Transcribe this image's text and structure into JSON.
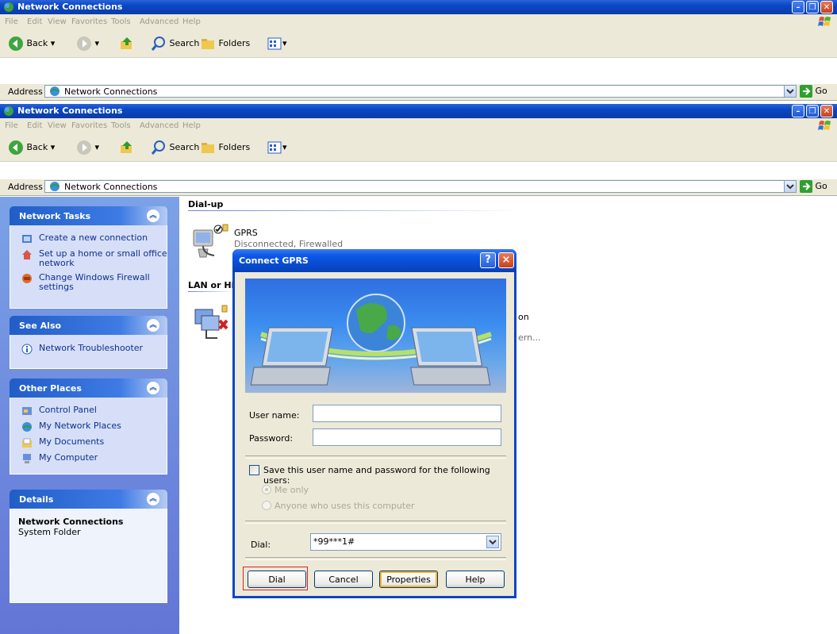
{
  "back_window": {
    "title": "Network Connections",
    "menu": [
      "File",
      "Edit",
      "View",
      "Favorites",
      "Tools",
      "Advanced",
      "Help"
    ],
    "toolbar": {
      "back": "Back",
      "search": "Search",
      "folders": "Folders"
    },
    "address_label": "Address",
    "address_value": "Network Connections",
    "go_label": "Go"
  },
  "window": {
    "title": "Network Connections",
    "menu": [
      "File",
      "Edit",
      "View",
      "Favorites",
      "Tools",
      "Advanced",
      "Help"
    ],
    "toolbar": {
      "back": "Back",
      "search": "Search",
      "folders": "Folders"
    },
    "address_label": "Address",
    "address_value": "Network Connections",
    "go_label": "Go"
  },
  "sidebar": {
    "network_tasks": {
      "title": "Network Tasks",
      "items": [
        "Create a new connection",
        "Set up a home or small office network",
        "Change Windows Firewall settings"
      ]
    },
    "see_also": {
      "title": "See Also",
      "items": [
        "Network Troubleshooter"
      ]
    },
    "other_places": {
      "title": "Other Places",
      "items": [
        "Control Panel",
        "My Network Places",
        "My Documents",
        "My Computer"
      ]
    },
    "details": {
      "title": "Details",
      "name": "Network Connections",
      "type": "System Folder"
    }
  },
  "content": {
    "dialup_header": "Dial-up",
    "gprs_name": "GPRS",
    "gprs_status": "Disconnected, Firewalled",
    "lan_header": "LAN or Hi",
    "lan_text_1": "on",
    "lan_text_2": "ern..."
  },
  "dialog": {
    "title": "Connect GPRS",
    "help_glyph": "?",
    "close_glyph": "×",
    "username_label": "User name:",
    "username_value": "",
    "password_label": "Password:",
    "password_value": "",
    "save_label": "Save this user name and password for the following users:",
    "save_checked": false,
    "me_only_label": "Me only",
    "anyone_label": "Anyone who uses this computer",
    "dial_label": "Dial:",
    "dial_value": "*99***1#",
    "buttons": {
      "dial": "Dial",
      "cancel": "Cancel",
      "properties": "Properties",
      "help": "Help"
    }
  },
  "colors": {
    "title_blue": "#0a46c4",
    "pane_blue": "#6375d6",
    "highlight_red": "#e0202a"
  }
}
